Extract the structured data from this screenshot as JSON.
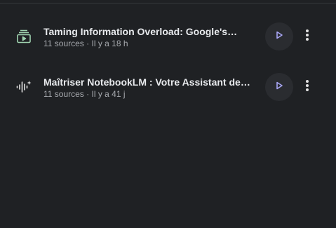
{
  "items": [
    {
      "title": "Taming Information Overload: Google's…",
      "sources": "11 sources",
      "separator": "·",
      "time": "Il y a 18 h",
      "icon": "video-overview-icon",
      "icon_color": "#9fd3b0"
    },
    {
      "title": "Maîtriser NotebookLM : Votre Assistant de…",
      "sources": "11 sources",
      "separator": "·",
      "time": "Il y a 41 j",
      "icon": "audio-overview-icon",
      "icon_color": "#e3e3e3"
    }
  ],
  "colors": {
    "background": "#1f2124",
    "play_button_bg": "#2a2c30",
    "play_icon": "#a9a6f5"
  }
}
